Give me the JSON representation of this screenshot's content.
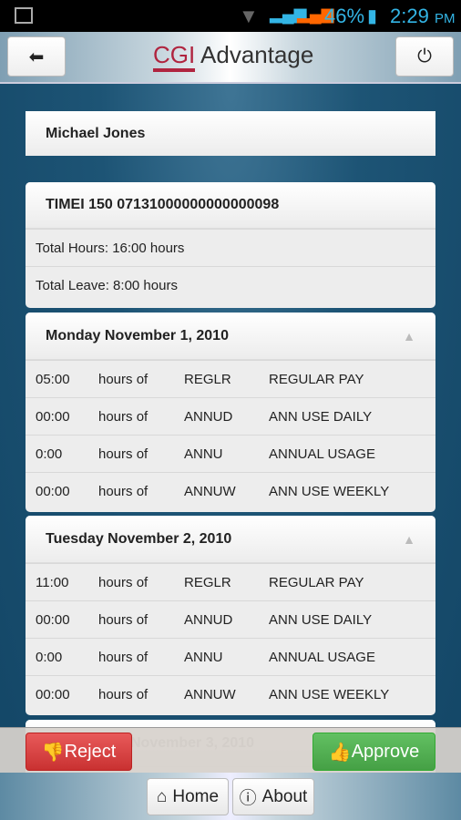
{
  "status": {
    "battery": "46%",
    "time": "2:29",
    "ampm": "PM"
  },
  "header": {
    "logo_cgi": "CGI",
    "logo_text": "Advantage"
  },
  "employee": "Michael Jones",
  "timesheet": {
    "id": "TIMEI 150 07131000000000000098",
    "total_hours": "Total Hours: 16:00 hours",
    "total_leave": "Total Leave: 8:00 hours"
  },
  "days": [
    {
      "title": "Monday November 1, 2010",
      "rows": [
        [
          "05:00",
          "hours of",
          "REGLR",
          "REGULAR PAY"
        ],
        [
          "00:00",
          "hours of",
          "ANNUD",
          "ANN USE DAILY"
        ],
        [
          "0:00",
          "hours of",
          "ANNU",
          "ANNUAL USAGE"
        ],
        [
          "00:00",
          "hours of",
          "ANNUW",
          "ANN USE WEEKLY"
        ]
      ]
    },
    {
      "title": "Tuesday November 2, 2010",
      "rows": [
        [
          "11:00",
          "hours of",
          "REGLR",
          "REGULAR PAY"
        ],
        [
          "00:00",
          "hours of",
          "ANNUD",
          "ANN USE DAILY"
        ],
        [
          "0:00",
          "hours of",
          "ANNU",
          "ANNUAL USAGE"
        ],
        [
          "00:00",
          "hours of",
          "ANNUW",
          "ANN USE WEEKLY"
        ]
      ]
    },
    {
      "title": "November 3, 2010",
      "rows": []
    }
  ],
  "actions": {
    "reject": "Reject",
    "approve": "Approve"
  },
  "nav": {
    "home": "Home",
    "about": "About"
  }
}
